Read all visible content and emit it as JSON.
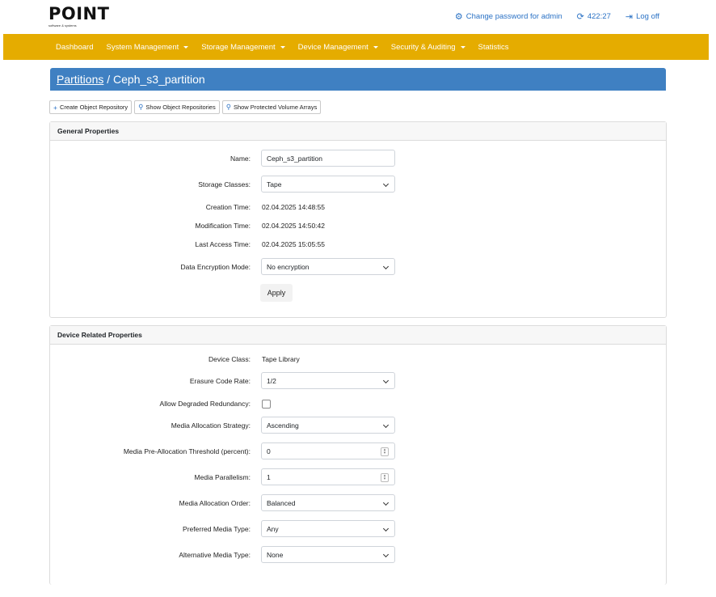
{
  "logo": {
    "text": "POINT",
    "subtitle": "software & systems"
  },
  "top_links": {
    "change_password": "Change password for admin",
    "session_timer": "422:27",
    "log_off": "Log off"
  },
  "nav": {
    "dashboard": "Dashboard",
    "system_management": "System Management",
    "storage_management": "Storage Management",
    "device_management": "Device Management",
    "security_auditing": "Security & Auditing",
    "statistics": "Statistics"
  },
  "header": {
    "breadcrumb_link": "Partitions",
    "separator": "/",
    "title": "Ceph_s3_partition"
  },
  "actions": {
    "create_repo": "Create Object Repository",
    "show_repos": "Show Object Repositories",
    "show_arrays": "Show Protected Volume Arrays"
  },
  "general": {
    "heading": "General Properties",
    "name_label": "Name:",
    "name_value": "Ceph_s3_partition",
    "storage_classes_label": "Storage Classes:",
    "storage_classes_value": "Tape",
    "creation_time_label": "Creation Time:",
    "creation_time_value": "02.04.2025 14:48:55",
    "modification_time_label": "Modification Time:",
    "modification_time_value": "02.04.2025 14:50:42",
    "last_access_label": "Last Access Time:",
    "last_access_value": "02.04.2025 15:05:55",
    "encryption_label": "Data Encryption Mode:",
    "encryption_value": "No encryption",
    "apply_label": "Apply"
  },
  "device": {
    "heading": "Device Related Properties",
    "device_class_label": "Device Class:",
    "device_class_value": "Tape Library",
    "erasure_label": "Erasure Code Rate:",
    "erasure_value": "1/2",
    "degraded_label": "Allow Degraded Redundancy:",
    "degraded_checked": false,
    "allocation_strategy_label": "Media Allocation Strategy:",
    "allocation_strategy_value": "Ascending",
    "preallocation_label": "Media Pre-Allocation Threshold (percent):",
    "preallocation_value": "0",
    "parallelism_label": "Media Parallelism:",
    "parallelism_value": "1",
    "allocation_order_label": "Media Allocation Order:",
    "allocation_order_value": "Balanced",
    "preferred_type_label": "Preferred Media Type:",
    "preferred_type_value": "Any",
    "alternative_type_label": "Alternative Media Type:",
    "alternative_type_value": "None"
  },
  "colors": {
    "nav_bg": "#e5ac00",
    "header_bg": "#3f80c2",
    "link": "#2b72c5"
  }
}
